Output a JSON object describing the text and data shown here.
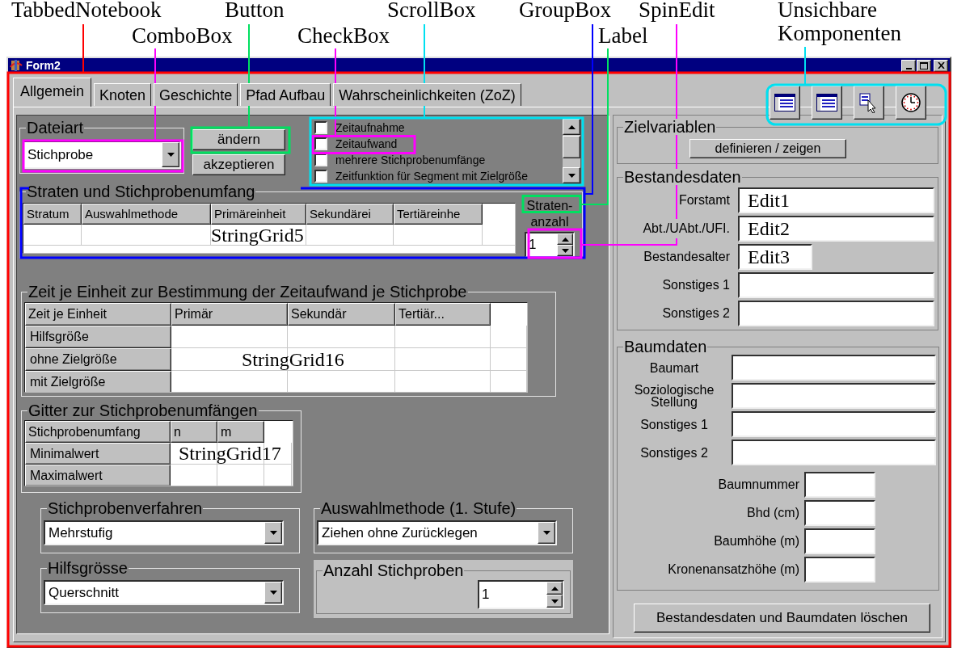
{
  "annotations": [
    {
      "label": "TabbedNotebook",
      "color": "#ff0000"
    },
    {
      "label": "ComboBox",
      "color": "#ff00ff"
    },
    {
      "label": "Button",
      "color": "#00e060"
    },
    {
      "label": "CheckBox",
      "color": "#ff00ff"
    },
    {
      "label": "ScrollBox",
      "color": "#00e0f0"
    },
    {
      "label": "GroupBox",
      "color": "#0000ff"
    },
    {
      "label": "Label",
      "color": "#00e060"
    },
    {
      "label": "SpinEdit",
      "color": "#ff00ff"
    },
    {
      "label": "Unsichbare Komponenten",
      "color": "#00e0f0"
    }
  ],
  "window": {
    "title": "Form2"
  },
  "tabs": [
    {
      "label": "Allgemein",
      "selected": true
    },
    {
      "label": "Knoten",
      "selected": false
    },
    {
      "label": "Geschichte",
      "selected": false
    },
    {
      "label": "Pfad Aufbau",
      "selected": false
    },
    {
      "label": "Wahrscheinlichkeiten (ZoZ)",
      "selected": false
    }
  ],
  "file_type": {
    "title": "Dateiart",
    "value": "Stichprobe"
  },
  "buttons": [
    "ändern",
    "akzeptieren"
  ],
  "options": [
    {
      "label": "Zeitaufnahme",
      "checked": false
    },
    {
      "label": "Zeitaufwand",
      "checked": false
    },
    {
      "label": "mehrere Stichprobenumfänge",
      "checked": false
    },
    {
      "label": "Zeitfunktion für Segment mit Zielgröße",
      "checked": false
    }
  ],
  "strata": {
    "title": "Straten und Stichprobenumfang",
    "columns": [
      "Stratum",
      "Auswahlmethode",
      "Primäreinheit",
      "Sekundärei",
      "Tertiäreinhe"
    ],
    "grid_name": "StringGrid5",
    "count_label": "Straten-anzahl",
    "count_value": "1"
  },
  "time_per_unit": {
    "title": "Zeit je Einheit zur Bestimmung der Zeitaufwand je Stichprobe",
    "columns": [
      "Zeit je Einheit",
      "Primär",
      "Sekundär",
      "Tertiär..."
    ],
    "rows": [
      "Hilfsgröße",
      "ohne Zielgröße",
      "mit Zielgröße"
    ],
    "grid_name": "StringGrid16"
  },
  "sample_grid": {
    "title": "Gitter zur Stichprobenumfängen",
    "columns": [
      "Stichprobenumfang",
      "n",
      "m"
    ],
    "rows": [
      "Minimalwert",
      "Maximalwert"
    ],
    "grid_name": "StringGrid17"
  },
  "selectors": [
    {
      "title": "Stichprobenverfahren",
      "value": "Mehrstufig"
    },
    {
      "title": "Auswahlmethode (1. Stufe)",
      "value": "Ziehen ohne Zurücklegen"
    },
    {
      "title": "Hilfsgrösse",
      "value": "Querschnitt"
    }
  ],
  "sample_count": {
    "title": "Anzahl Stichproben",
    "value": "1"
  },
  "target_variables": {
    "title": "Zielvariablen",
    "button": "definieren / zeigen"
  },
  "stand_data": {
    "title": "Bestandesdaten",
    "fields": [
      {
        "label": "Forstamt",
        "value": "Edit1",
        "kind": "wide"
      },
      {
        "label": "Abt./UAbt./UFI.",
        "value": "Edit2",
        "kind": "wide"
      },
      {
        "label": "Bestandesalter",
        "value": "Edit3",
        "kind": "short"
      },
      {
        "label": "Sonstiges 1",
        "kind": "wide"
      },
      {
        "label": "Sonstiges 2",
        "kind": "wide"
      }
    ]
  },
  "tree_data": {
    "title": "Baumdaten",
    "fields": [
      {
        "label": "Baumart"
      },
      {
        "label": "Soziologische Stellung"
      },
      {
        "label": "Sonstiges 1"
      },
      {
        "label": "Sonstiges 2"
      }
    ],
    "measurements": [
      {
        "label": "Baumnummer"
      },
      {
        "label": "Bhd (cm)"
      },
      {
        "label": "Baumhöhe (m)"
      },
      {
        "label": "Kronenansatzhöhe (m)"
      }
    ]
  },
  "clear_button": "Bestandesdaten und Baumdaten löschen"
}
